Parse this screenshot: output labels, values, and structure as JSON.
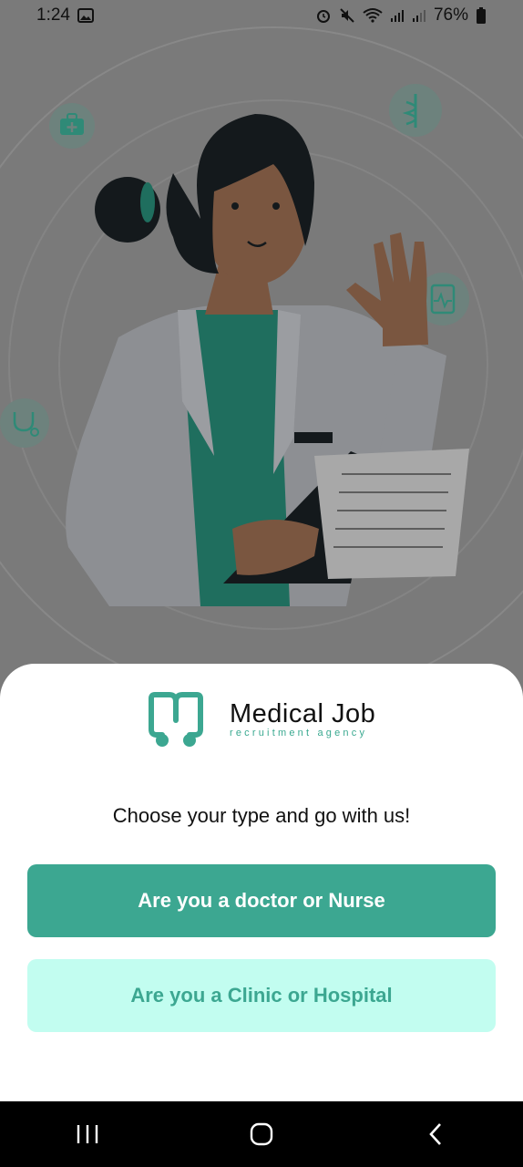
{
  "status_bar": {
    "time": "1:24",
    "battery_percent": "76%",
    "icons": [
      "image-icon",
      "alarm-icon",
      "mute-icon",
      "wifi-icon",
      "signal-icon",
      "signal-icon",
      "battery-icon"
    ]
  },
  "colors": {
    "accent": "#3ca791",
    "accent_light": "#c2fdf0",
    "overlay": "#7a7a7a"
  },
  "logo": {
    "title": "Medical Job",
    "subtitle": "recruitment agency"
  },
  "prompt": "Choose your type and go with us!",
  "buttons": {
    "doctor_label": "Are you a doctor or Nurse",
    "clinic_label": "Are you a Clinic or Hospital"
  },
  "nav": {
    "icons": [
      "recent-apps-icon",
      "home-icon",
      "back-icon"
    ]
  }
}
